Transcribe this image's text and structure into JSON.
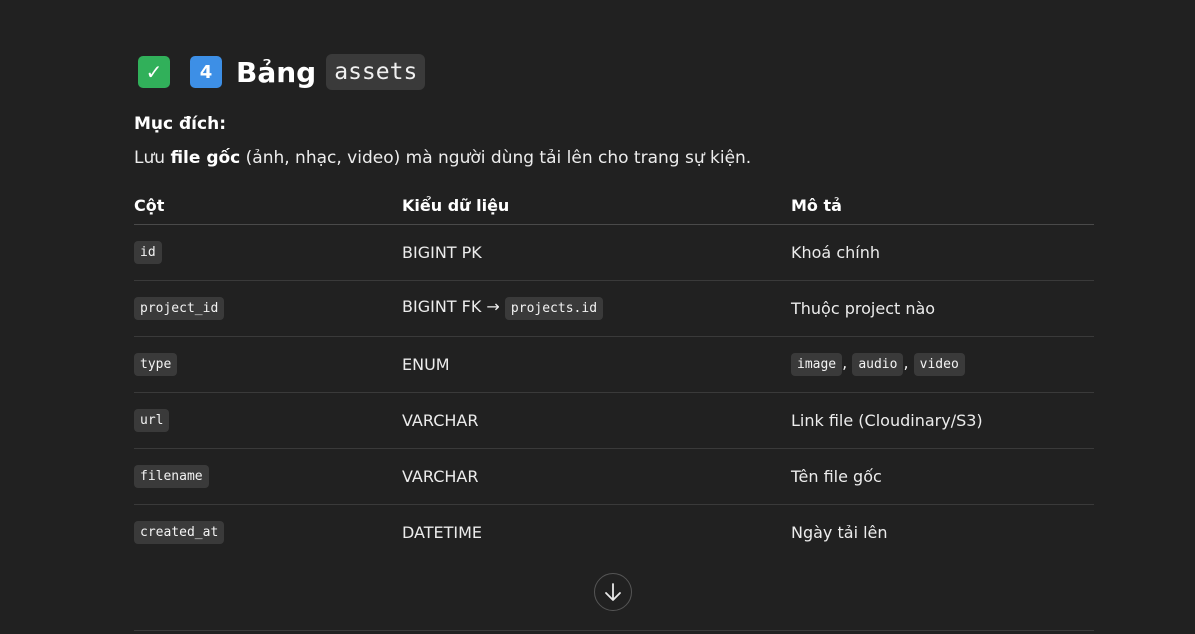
{
  "heading": {
    "check_emoji": "✓",
    "number_emoji": "4",
    "word": "Bảng",
    "code": "assets"
  },
  "purpose": {
    "label": "Mục đích:",
    "prefix": "Lưu ",
    "bold": "file gốc",
    "suffix": " (ảnh, nhạc, video) mà người dùng tải lên cho trang sự kiện."
  },
  "table": {
    "headers": [
      "Cột",
      "Kiểu dữ liệu",
      "Mô tả"
    ],
    "rows": [
      {
        "column": "id",
        "type": "BIGINT PK",
        "desc": "Khoá chính"
      },
      {
        "column": "project_id",
        "type": "BIGINT FK →",
        "type_code": "projects.id",
        "desc": "Thuộc project nào"
      },
      {
        "column": "type",
        "type": "ENUM",
        "desc_codes": [
          "image",
          "audio",
          "video"
        ],
        "sep": ","
      },
      {
        "column": "url",
        "type": "VARCHAR",
        "desc": "Link file (Cloudinary/S3)"
      },
      {
        "column": "filename",
        "type": "VARCHAR",
        "desc": "Tên file gốc"
      },
      {
        "column": "created_at",
        "type": "DATETIME",
        "desc": "Ngày tải lên"
      }
    ]
  },
  "scroll_button_icon": "arrow-down-icon",
  "colors": {
    "background": "#212121",
    "code_bg": "#3a3a3a",
    "check": "#31b05a",
    "keycap": "#3d8fe6"
  }
}
